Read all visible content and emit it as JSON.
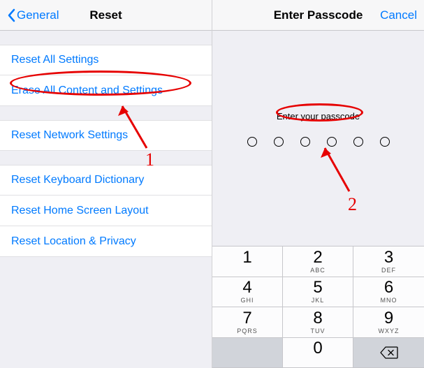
{
  "left": {
    "back_label": "General",
    "title": "Reset",
    "group1": [
      "Reset All Settings",
      "Erase All Content and Settings"
    ],
    "group2": [
      "Reset Network Settings"
    ],
    "group3": [
      "Reset Keyboard Dictionary",
      "Reset Home Screen Layout",
      "Reset Location & Privacy"
    ]
  },
  "right": {
    "title": "Enter Passcode",
    "cancel": "Cancel",
    "prompt": "Enter your passcode",
    "keypad": [
      {
        "digit": "1",
        "letters": ""
      },
      {
        "digit": "2",
        "letters": "ABC"
      },
      {
        "digit": "3",
        "letters": "DEF"
      },
      {
        "digit": "4",
        "letters": "GHI"
      },
      {
        "digit": "5",
        "letters": "JKL"
      },
      {
        "digit": "6",
        "letters": "MNO"
      },
      {
        "digit": "7",
        "letters": "PQRS"
      },
      {
        "digit": "8",
        "letters": "TUV"
      },
      {
        "digit": "9",
        "letters": "WXYZ"
      }
    ],
    "zero": "0"
  },
  "annotations": {
    "label1": "1",
    "label2": "2"
  }
}
